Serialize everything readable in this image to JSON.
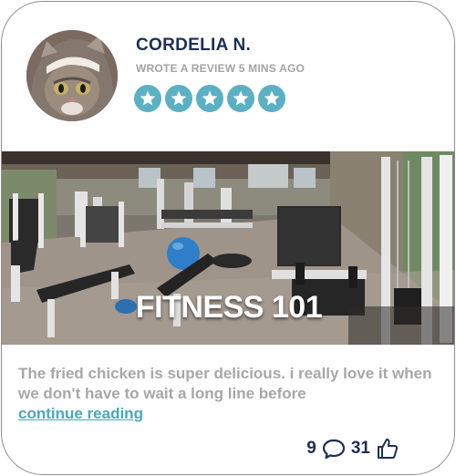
{
  "review": {
    "author": "CORDELIA N.",
    "subline": "WROTE A REVIEW 5 MINS AGO",
    "rating": 5,
    "rating_max": 5,
    "image_caption": "FITNESS 101",
    "text": "The fried chicken is super delicious. i really love it when we don't have to wait a long line before",
    "continue_label": "continue reading",
    "comments_count": "9",
    "likes_count": "31"
  },
  "colors": {
    "name": "#1c2f55",
    "muted": "#a3a3a3",
    "star_bg": "#5cb0c4",
    "link": "#4aa7bd"
  },
  "icons": {
    "comment": "speech-bubble-icon",
    "like": "thumbs-up-icon",
    "star": "star-icon"
  }
}
